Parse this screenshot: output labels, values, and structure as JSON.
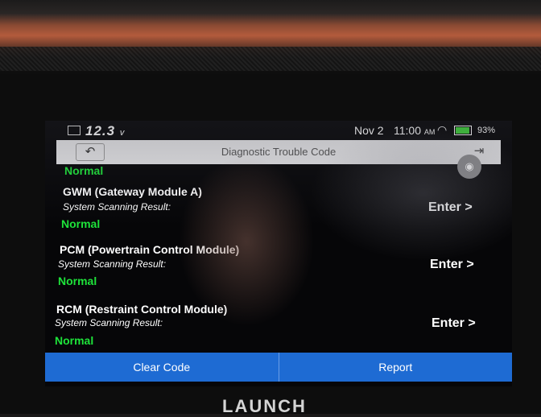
{
  "status_bar": {
    "voltage": "12.3",
    "voltage_unit": "v",
    "date": "Nov 2",
    "time": "11:00",
    "am_pm": "AM",
    "battery_percent": "93%",
    "battery_level": 0.93
  },
  "title_bar": {
    "title": "Diagnostic Trouble Code",
    "back_icon": "back-arrow-icon",
    "exit_icon": "exit-icon"
  },
  "camera_icon": "camera-icon",
  "partial_top_status": "Normal",
  "modules": [
    {
      "name": "GWM (Gateway Module A)",
      "result_label": "System Scanning Result:",
      "status": "Normal",
      "action": "Enter >"
    },
    {
      "name": "PCM (Powertrain Control Module)",
      "result_label": "System Scanning Result:",
      "status": "Normal",
      "action": "Enter >"
    },
    {
      "name": "RCM (Restraint Control Module)",
      "result_label": "System Scanning Result:",
      "status": "Normal",
      "action": "Enter >"
    }
  ],
  "footer_buttons": {
    "clear_code": "Clear Code",
    "report": "Report"
  },
  "brand": "LAUNCH",
  "colors": {
    "status_normal": "#1ee33a",
    "button_blue": "#1e6bd3",
    "device_orange": "#b35b3c"
  }
}
